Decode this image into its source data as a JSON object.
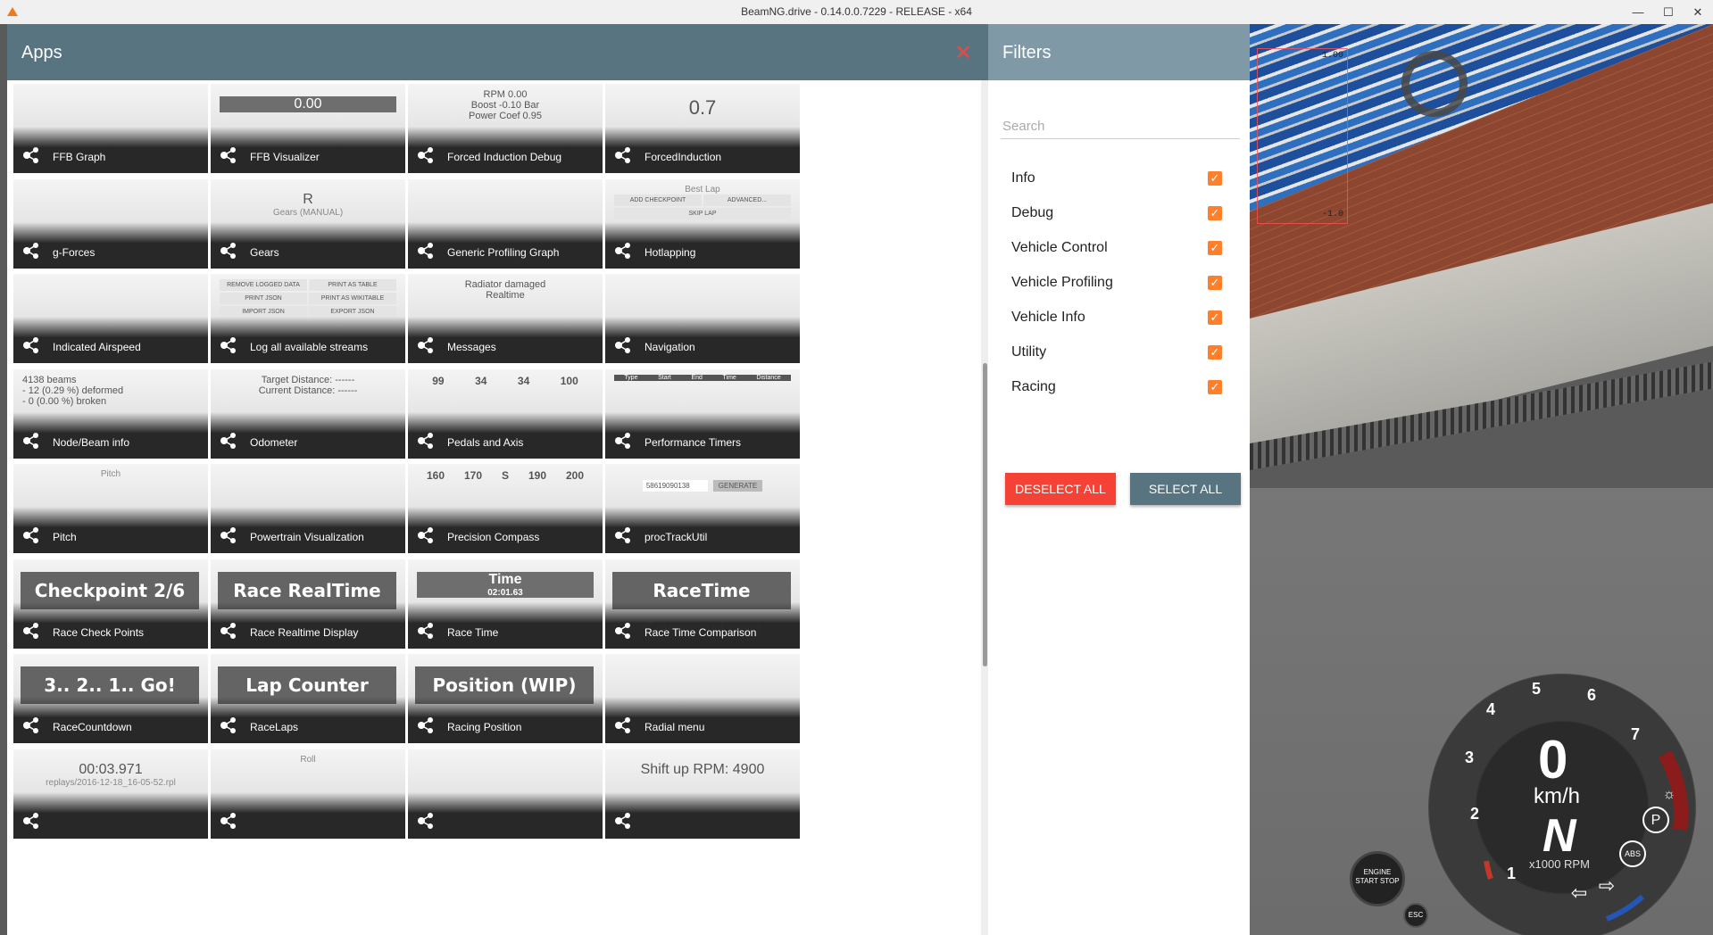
{
  "window": {
    "title": "BeamNG.drive - 0.14.0.0.7229 - RELEASE - x64",
    "controls": {
      "minimize": "—",
      "maximize": "☐",
      "close": "✕"
    }
  },
  "apps_panel": {
    "title": "Apps",
    "close_glyph": "✕",
    "tiles": [
      {
        "label": "FFB Graph"
      },
      {
        "label": "FFB Visualizer",
        "preview": "0.00"
      },
      {
        "label": "Forced Induction Debug",
        "preview_lines": [
          "RPM  0.00",
          "Boost  -0.10 Bar",
          "Power Coef  0.95"
        ]
      },
      {
        "label": "ForcedInduction",
        "preview": "0.7"
      },
      {
        "label": "g-Forces"
      },
      {
        "label": "Gears",
        "preview": "R",
        "preview_sub": "Gears (MANUAL)"
      },
      {
        "label": "Generic Profiling Graph"
      },
      {
        "label": "Hotlapping",
        "preview_buttons": [
          "ADD CHECKPOINT",
          "ADVANCED...",
          "SKIP LAP"
        ],
        "preview_sub": "Best Lap"
      },
      {
        "label": "Indicated Airspeed"
      },
      {
        "label": "Log all available streams",
        "preview_buttons": [
          "REMOVE LOGGED DATA",
          "PRINT AS TABLE",
          "PRINT JSON",
          "PRINT AS WIKITABLE",
          "IMPORT JSON",
          "EXPORT JSON"
        ]
      },
      {
        "label": "Messages",
        "preview_lines": [
          "Radiator damaged",
          "Realtime"
        ]
      },
      {
        "label": "Navigation"
      },
      {
        "label": "Node/Beam info",
        "preview_lines": [
          "4138 beams",
          "- 12 (0.29 %) deformed",
          "- 0 (0.00 %) broken"
        ]
      },
      {
        "label": "Odometer",
        "preview_lines": [
          "Target Distance: ------",
          "Current Distance: ------"
        ]
      },
      {
        "label": "Pedals and Axis",
        "preview_values": [
          "99",
          "34",
          "34",
          "100"
        ]
      },
      {
        "label": "Performance Timers",
        "preview_cols": [
          "Type",
          "Start",
          "End",
          "Time",
          "Distance"
        ]
      },
      {
        "label": "Pitch",
        "preview_sub": "Pitch"
      },
      {
        "label": "Powertrain Visualization"
      },
      {
        "label": "Precision Compass",
        "preview_values": [
          "160",
          "170",
          "S",
          "190",
          "200"
        ]
      },
      {
        "label": "procTrackUtil",
        "preview_input": "58619090138",
        "preview_button": "GENERATE"
      },
      {
        "label": "Race Check Points",
        "preview": "Checkpoint 2/6"
      },
      {
        "label": "Race Realtime Display",
        "preview": "Race RealTime"
      },
      {
        "label": "Race Time",
        "preview": "Time",
        "preview_sub": "02:01.63"
      },
      {
        "label": "Race Time Comparison",
        "preview": "RaceTime Comparison"
      },
      {
        "label": "RaceCountdown",
        "preview": "3.. 2.. 1.. Go!"
      },
      {
        "label": "RaceLaps",
        "preview": "Lap Counter"
      },
      {
        "label": "Racing Position",
        "preview": "Position (WIP)"
      },
      {
        "label": "Radial menu"
      },
      {
        "label": "",
        "preview": "00:03.971",
        "preview_sub": "replays/2016-12-18_16-05-52.rpl"
      },
      {
        "label": "",
        "preview_sub": "Roll"
      },
      {
        "label": ""
      },
      {
        "label": "",
        "preview": "Shift up RPM: 4900"
      }
    ]
  },
  "filters_panel": {
    "title": "Filters",
    "search_placeholder": "Search",
    "categories": [
      {
        "label": "Info",
        "checked": true
      },
      {
        "label": "Debug",
        "checked": true
      },
      {
        "label": "Vehicle Control",
        "checked": true
      },
      {
        "label": "Vehicle Profiling",
        "checked": true
      },
      {
        "label": "Vehicle Info",
        "checked": true
      },
      {
        "label": "Utility",
        "checked": true
      },
      {
        "label": "Racing",
        "checked": true
      }
    ],
    "deselect_all": "DESELECT ALL",
    "select_all": "SELECT ALL"
  },
  "hud": {
    "speed": "0",
    "speed_unit": "km/h",
    "gear": "N",
    "rpm_unit": "x1000 RPM",
    "rpm_marks": [
      "1",
      "2",
      "3",
      "4",
      "5",
      "6",
      "7"
    ],
    "engine_button": "ENGINE START STOP",
    "esc_button": "ESC",
    "abs_label": "ABS",
    "parking_label": "P"
  },
  "ffb_overlay": {
    "top_value": "1.00",
    "bottom_value": "-1.0"
  },
  "colors": {
    "apps_header": "#587481",
    "filters_header": "#8099a6",
    "checkbox": "#ff7f2a",
    "deselect_button": "#f44336",
    "select_button": "#587481",
    "close_icon": "#e84a43"
  }
}
